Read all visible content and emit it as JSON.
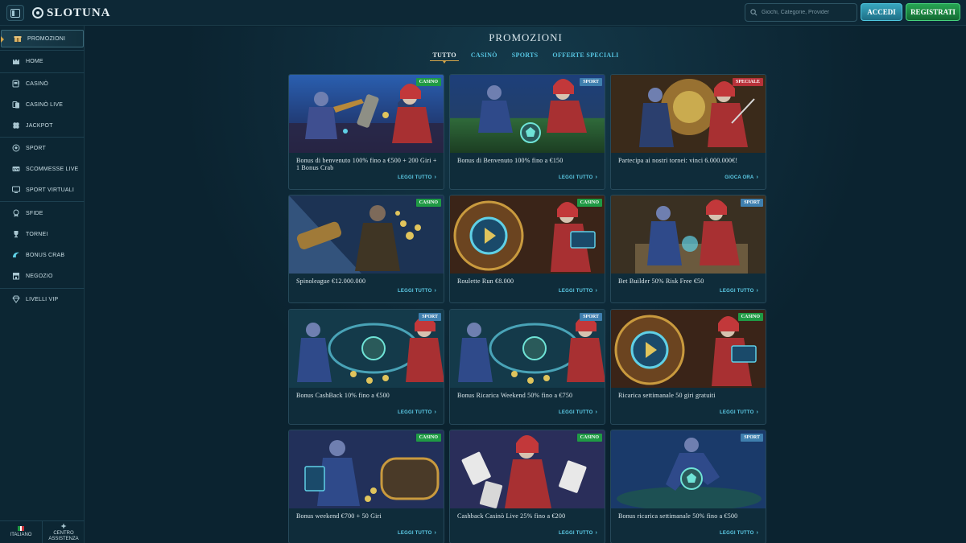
{
  "header": {
    "logo": "SLOTUNA",
    "search_placeholder": "Giochi, Categorie, Provider",
    "login_label": "ACCEDI",
    "register_label": "REGISTRATI"
  },
  "sidebar": {
    "items": [
      {
        "label": "PROMOZIONI",
        "icon": "gift-icon",
        "active": true
      },
      {
        "label": "HOME",
        "icon": "castle-icon"
      },
      {
        "label": "CASINÒ",
        "icon": "slot-machine-icon"
      },
      {
        "label": "CASINÒ LIVE",
        "icon": "live-cards-icon"
      },
      {
        "label": "JACKPOT",
        "icon": "clover-icon"
      },
      {
        "label": "SPORT",
        "icon": "ball-icon"
      },
      {
        "label": "SCOMMESSE LIVE",
        "icon": "live-tv-icon"
      },
      {
        "label": "SPORT VIRTUALI",
        "icon": "monitor-icon"
      },
      {
        "label": "SFIDE",
        "icon": "medal-icon"
      },
      {
        "label": "TORNEI",
        "icon": "trophy-icon"
      },
      {
        "label": "BONUS CRAB",
        "icon": "crab-claw-icon"
      },
      {
        "label": "NEGOZIO",
        "icon": "shop-icon"
      },
      {
        "label": "LIVELLI VIP",
        "icon": "diamond-icon"
      }
    ],
    "footer": {
      "language": "ITALIANO",
      "support": "CENTRO ASSISTENZA"
    }
  },
  "main": {
    "title": "PROMOZIONI",
    "tabs": [
      "TUTTO",
      "CASINÒ",
      "SPORTS",
      "OFFERTE SPECIALI"
    ],
    "active_tab": 0
  },
  "badge_colors": {
    "CASINO": "#1f9a44",
    "SPORT": "#3f7fae",
    "SPECIALE": "#b8323a"
  },
  "promos": [
    {
      "badge": "CASINO",
      "title": "Bonus di benvenuto 100% fino a €500 + 200 Giri + 1 Bonus Crab",
      "cta": "LEGGI TUTTO",
      "art": "hero-vs-mage-crab"
    },
    {
      "badge": "SPORT",
      "title": "Bonus di Benvenuto 100% fino a €150",
      "cta": "LEGGI TUTTO",
      "art": "stadium-ball"
    },
    {
      "badge": "SPECIALE",
      "title": "Partecipa ai nostri tornei: vinci 6.000.000€!",
      "cta": "GIOCA ORA",
      "art": "golden-gate"
    },
    {
      "badge": "CASINO",
      "title": "Spinoleague €12.000.000",
      "cta": "LEGGI TUTTO",
      "art": "coin-telescope"
    },
    {
      "badge": "CASINO",
      "title": "Roulette Run €8.000",
      "cta": "LEGGI TUTTO",
      "art": "roulette-wheel"
    },
    {
      "badge": "SPORT",
      "title": "Bet Builder 50% Risk Free €50",
      "cta": "LEGGI TUTTO",
      "art": "map-table"
    },
    {
      "badge": "SPORT",
      "title": "Bonus CashBack 10% fino a €500",
      "cta": "LEGGI TUTTO",
      "art": "coin-vortex"
    },
    {
      "badge": "SPORT",
      "title": "Bonus Ricarica Weekend 50% fino a €750",
      "cta": "LEGGI TUTTO",
      "art": "coin-vortex"
    },
    {
      "badge": "CASINO",
      "title": "Ricarica settimanale 50 giri gratuiti",
      "cta": "LEGGI TUTTO",
      "art": "roulette-wheel"
    },
    {
      "badge": "CASINO",
      "title": "Bonus weekend €700 + 50 Giri",
      "cta": "LEGGI TUTTO",
      "art": "treasure-chest"
    },
    {
      "badge": "CASINO",
      "title": "Cashback Casinò Live 25% fino a €200",
      "cta": "LEGGI TUTTO",
      "art": "flying-cards"
    },
    {
      "badge": "SPORT",
      "title": "Bonus ricarica settimanale 50% fino a €500",
      "cta": "LEGGI TUTTO",
      "art": "ball-strike"
    }
  ]
}
